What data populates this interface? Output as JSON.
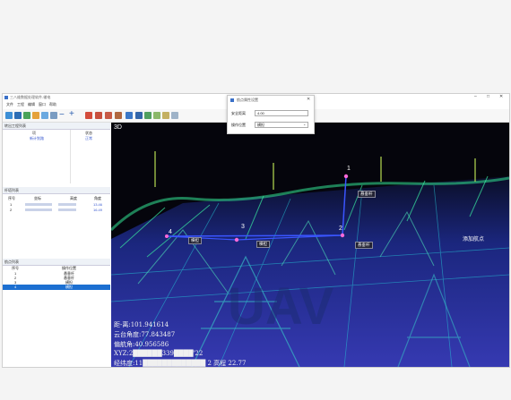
{
  "app": {
    "title": "三八维数据处理软件-输电"
  },
  "menu": [
    "文件",
    "工程",
    "编辑",
    "窗口",
    "帮助"
  ],
  "panels": {
    "project": {
      "title": "转出工程列表",
      "col_name": "项",
      "col_status": "状态",
      "row_name": "新计划路",
      "row_status": "正常"
    },
    "tower": {
      "title": "杆塔列表",
      "headers": [
        "序号",
        "坐标",
        "高度",
        "角度"
      ],
      "rows": [
        {
          "index": "1",
          "val": "13.46"
        },
        {
          "index": "2",
          "val": "16.49"
        }
      ]
    },
    "points": {
      "title": "航点列表",
      "headers": [
        "序号",
        "操作位置"
      ],
      "rows": [
        {
          "index": "1",
          "op": "悬垂杆"
        },
        {
          "index": "2",
          "op": "悬垂杆"
        },
        {
          "index": "3",
          "op": "横担"
        },
        {
          "index": "4",
          "op": "横担"
        }
      ]
    }
  },
  "viewport": {
    "mode_label": "3D",
    "points": [
      "1",
      "2",
      "3",
      "4"
    ],
    "labels": {
      "a": "悬垂杆",
      "b": "悬垂杆",
      "c": "横担",
      "d": "横担",
      "e": "添加航点"
    },
    "watermark": "UAV",
    "hud": {
      "line1": "距-离:101.941614",
      "line2": "云台角度:77.843487",
      "line3": "偏航角:40.956586",
      "line4": "XYZ:2██████339████'22",
      "line5": "经纬度:11█████████████ 2 高程 22.77"
    }
  },
  "dialog": {
    "title": "航点属性设置",
    "field1_label": "安全距离",
    "field1_value": "4.00",
    "field2_label": "操作位置",
    "field2_value": "横担"
  }
}
